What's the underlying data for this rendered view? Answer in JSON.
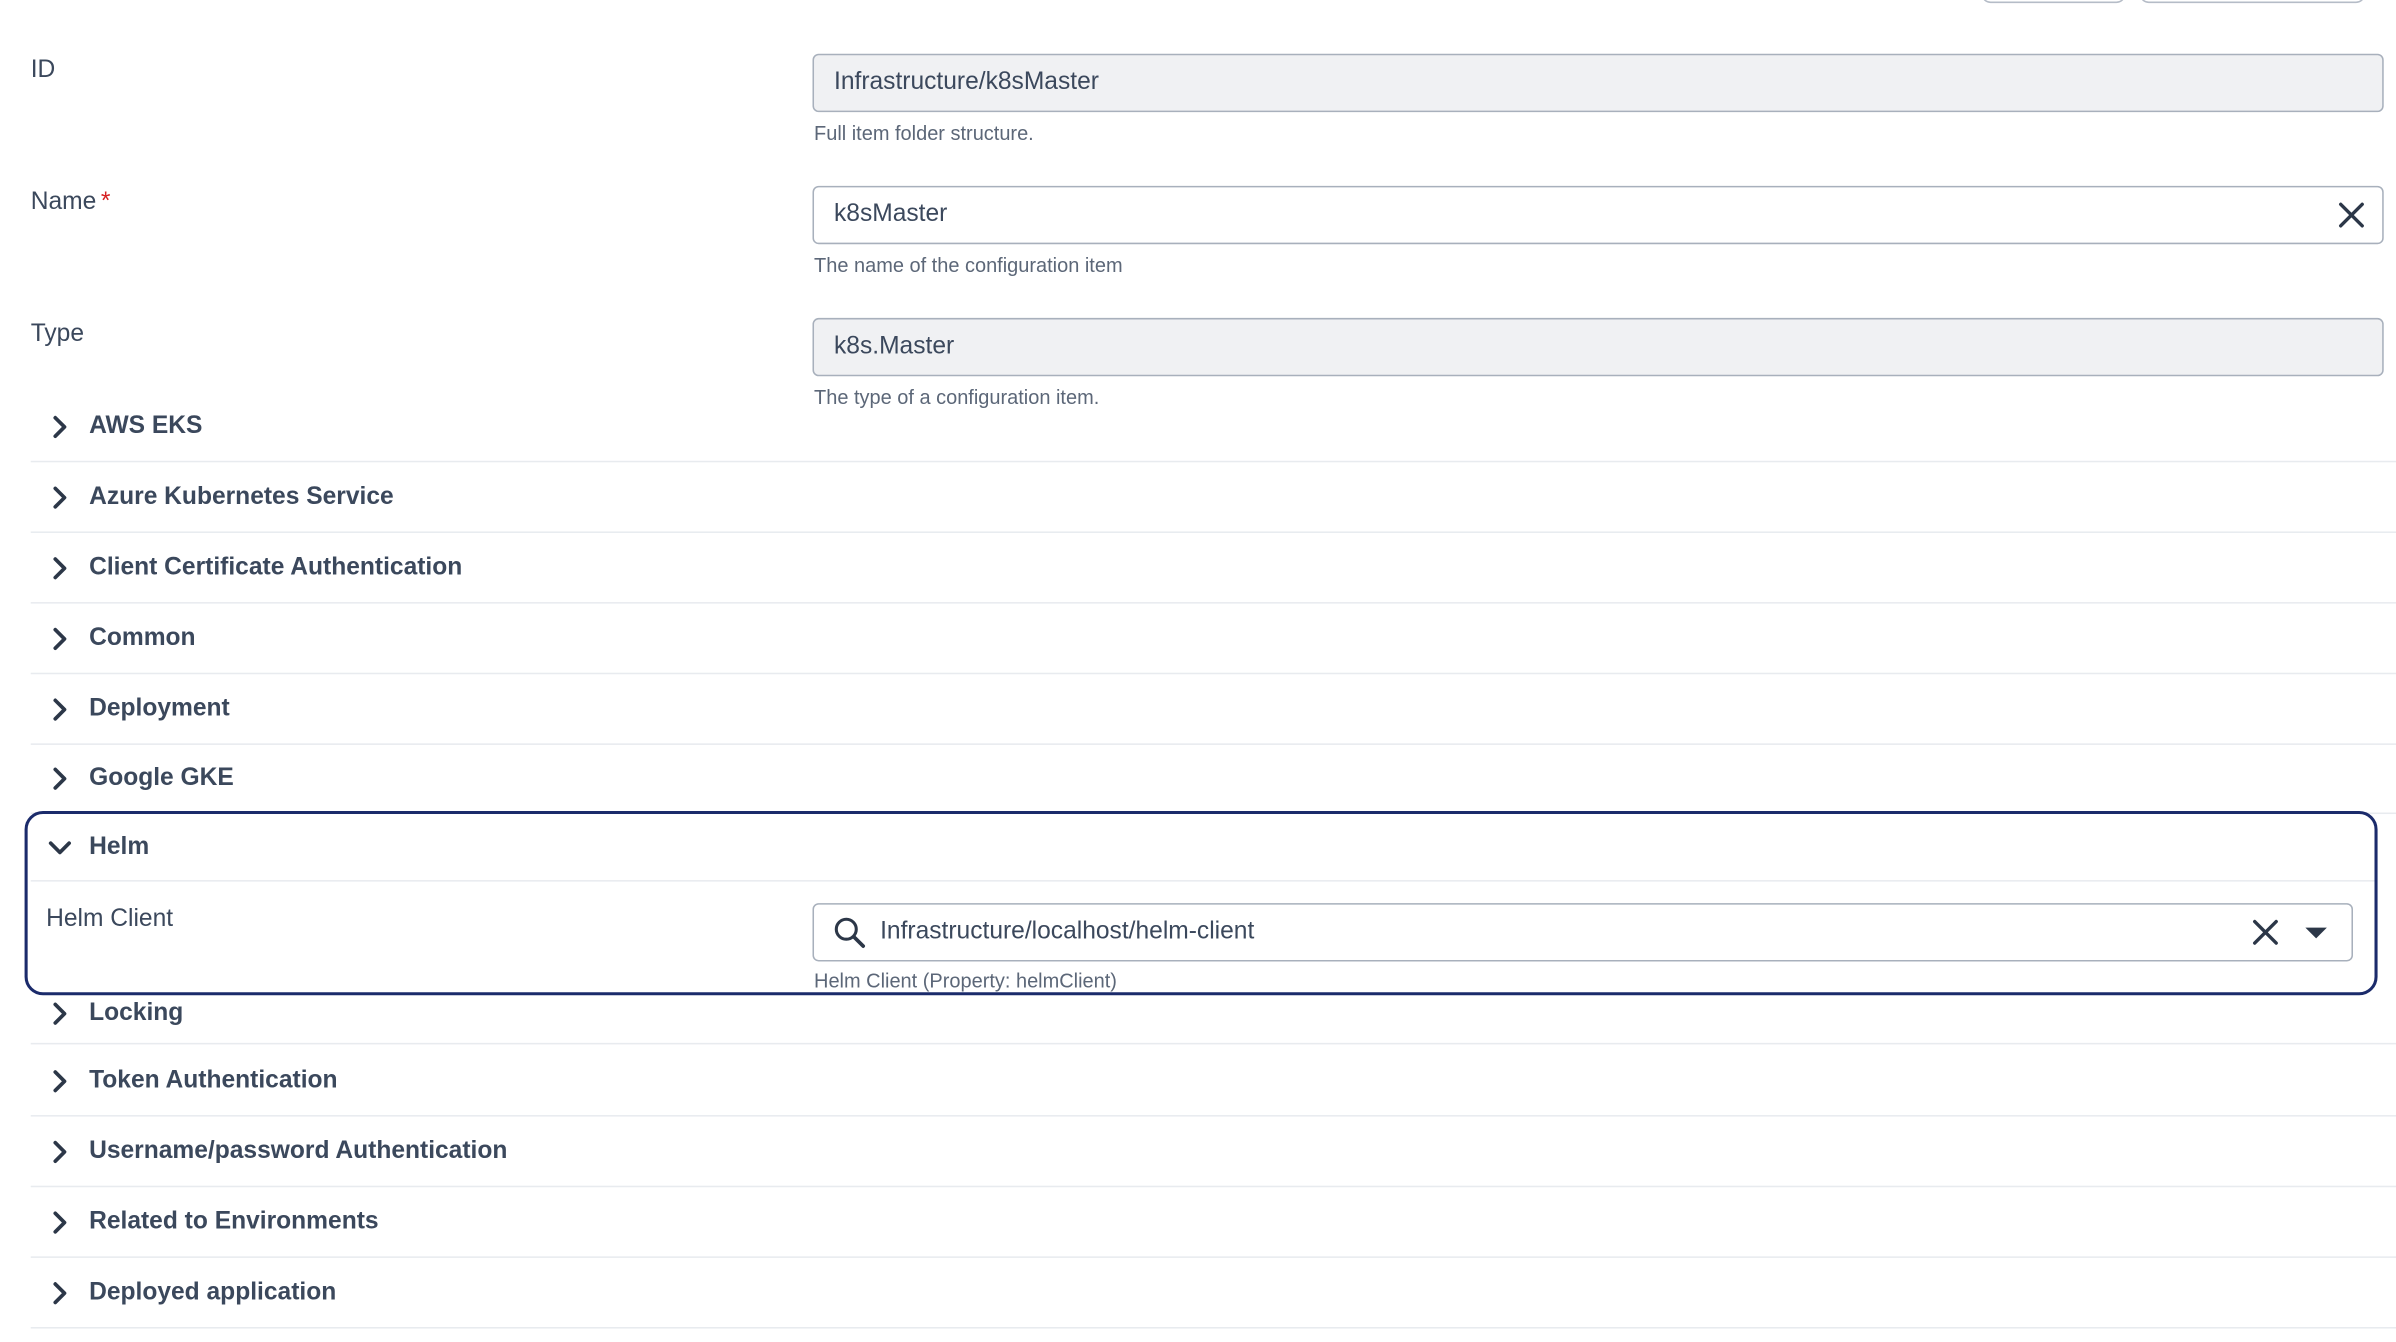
{
  "fields": {
    "id": {
      "label": "ID",
      "value": "Infrastructure/k8sMaster",
      "helper": "Full item folder structure."
    },
    "name": {
      "label": "Name",
      "required_mark": "*",
      "value": "k8sMaster",
      "helper": "The name of the configuration item"
    },
    "type": {
      "label": "Type",
      "value": "k8s.Master",
      "helper": "The type of a configuration item."
    }
  },
  "sections": {
    "aws_eks": "AWS EKS",
    "azure": "Azure Kubernetes Service",
    "client_cert": "Client Certificate Authentication",
    "common": "Common",
    "deployment": "Deployment",
    "google_gke": "Google GKE",
    "locking": "Locking",
    "token_auth": "Token Authentication",
    "userpass_auth": "Username/password Authentication",
    "related_env": "Related to Environments",
    "deployed_app": "Deployed application"
  },
  "helm": {
    "title": "Helm",
    "client_label": "Helm Client",
    "client_value": "Infrastructure/localhost/helm-client",
    "client_helper": "Helm Client (Property: helmClient)"
  },
  "icons": {
    "collapsed": "chevron-right-icon",
    "expanded": "chevron-down-icon",
    "clear": "close-icon",
    "search": "search-icon",
    "dropdown": "caret-down-icon"
  },
  "colors": {
    "focus_border": "#1b2b6b",
    "required": "#d61f21",
    "text": "#3b485c"
  }
}
